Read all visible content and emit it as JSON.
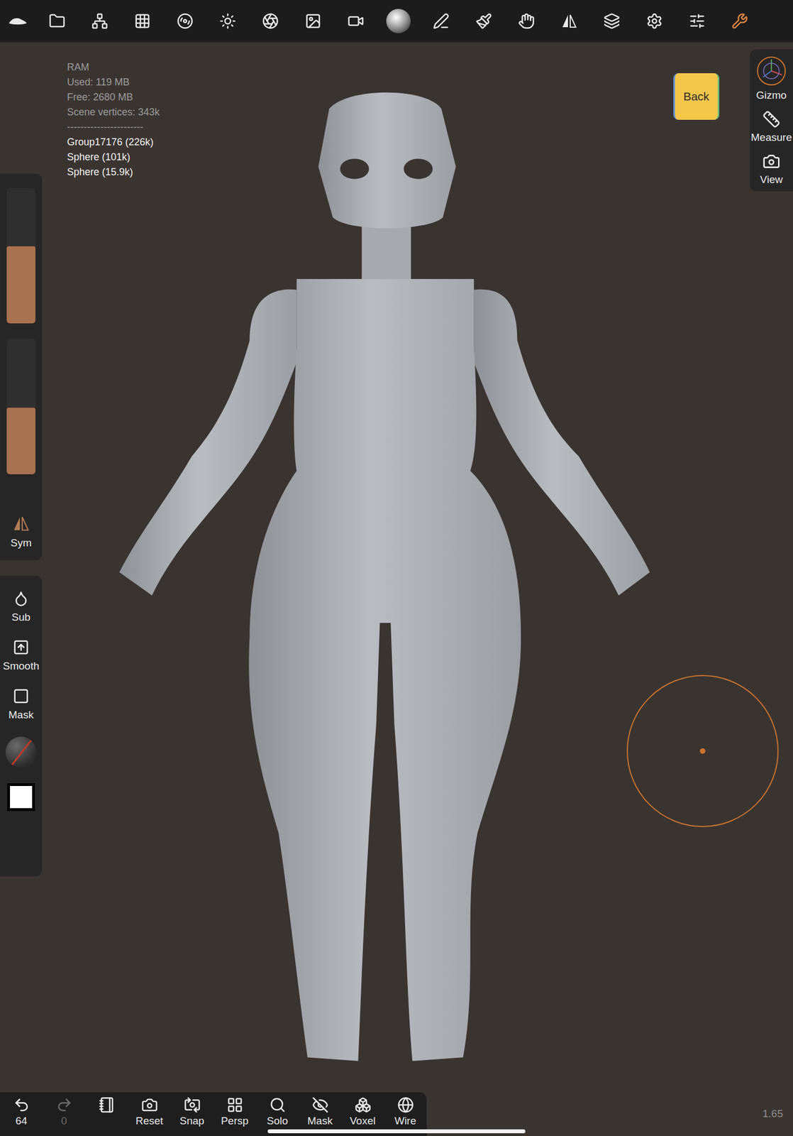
{
  "top_tools": [
    {
      "selected": false
    },
    {
      "selected": false
    },
    {
      "selected": false
    },
    {
      "selected": false
    },
    {
      "selected": false
    },
    {
      "selected": false
    },
    {
      "selected": false
    },
    {
      "selected": false
    },
    {
      "selected": false
    },
    {
      "selected": false
    },
    {
      "selected": false
    },
    {
      "selected": false
    },
    {
      "selected": false
    },
    {
      "selected": false
    },
    {
      "selected": false
    },
    {
      "selected": false
    },
    {
      "selected": false
    },
    {
      "selected": true
    }
  ],
  "stats": {
    "title": "RAM",
    "lines": [
      "Used: 119 MB",
      "Free: 2680 MB",
      "Scene vertices: 343k"
    ],
    "separator": "-----------------------",
    "objects": [
      "Group17176 (226k)",
      "Sphere (101k)",
      "Sphere (15.9k)"
    ]
  },
  "back_button": "Back",
  "right_panel": [
    {
      "label": "Gizmo"
    },
    {
      "label": "Measure"
    },
    {
      "label": "View"
    }
  ],
  "sliders": [
    {
      "level": 0.57,
      "color": "#a8714f"
    },
    {
      "level": 0.49,
      "color": "#a8714f"
    }
  ],
  "sym_button": {
    "label": "Sym"
  },
  "left_tools": [
    {
      "label": "Sub"
    },
    {
      "label": "Smooth"
    },
    {
      "label": "Mask"
    }
  ],
  "bottom_bar": [
    {
      "label": "64",
      "disabled": false
    },
    {
      "label": "0",
      "disabled": true
    },
    {
      "label": "",
      "disabled": false
    },
    {
      "label": "Reset",
      "disabled": false
    },
    {
      "label": "Snap",
      "disabled": false
    },
    {
      "label": "Persp",
      "disabled": false
    },
    {
      "label": "Solo",
      "disabled": false
    },
    {
      "label": "Mask",
      "disabled": false
    },
    {
      "label": "Voxel",
      "disabled": false
    },
    {
      "label": "Wire",
      "disabled": false
    }
  ],
  "zoom": "1.65"
}
